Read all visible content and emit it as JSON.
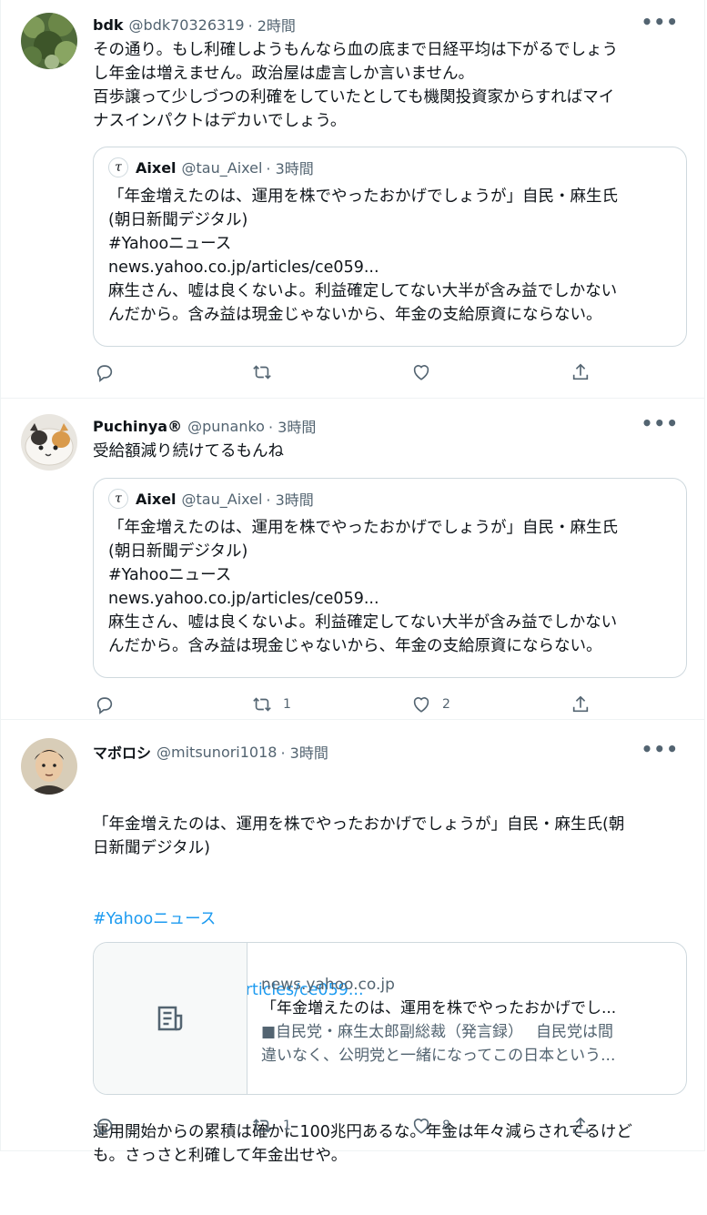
{
  "tweets": [
    {
      "name": "bdk",
      "handle": "@bdk70326319",
      "time": "· 2時間",
      "text": "その通り。もし利確しようもんなら血の底まで日経平均は下がるでしょう\nし年金は増えません。政治屋は虚言しか言いません。\n百歩譲って少しづつの利確をしていたとしても機関投資家からすればマイ\nナスインパクトはデカいでしょう。",
      "quote": {
        "name": "Aixel",
        "avatar_glyph": "τ",
        "handle": "@tau_Aixel",
        "time": "· 3時間",
        "text": "「年金増えたのは、運用を株でやったおかげでしょうが」自民・麻生氏\n(朝日新聞デジタル)\n#Yahooニュース\nnews.yahoo.co.jp/articles/ce059...\n麻生さん、嘘は良くないよ。利益確定してない大半が含み益でしかない\nんだから。含み益は現金じゃないから、年金の支給原資にならない。"
      },
      "retweets": "",
      "likes": ""
    },
    {
      "name": "Puchinya®",
      "handle": "@punanko",
      "time": "· 3時間",
      "text": "受給額減り続けてるもんね",
      "quote": {
        "name": "Aixel",
        "avatar_glyph": "τ",
        "handle": "@tau_Aixel",
        "time": "· 3時間",
        "text": "「年金増えたのは、運用を株でやったおかげでしょうが」自民・麻生氏\n(朝日新聞デジタル)\n#Yahooニュース\nnews.yahoo.co.jp/articles/ce059...\n麻生さん、嘘は良くないよ。利益確定してない大半が含み益でしかない\nんだから。含み益は現金じゃないから、年金の支給原資にならない。"
      },
      "retweets": "1",
      "likes": "2"
    },
    {
      "name": "マボロシ",
      "handle": "@mitsunori1018",
      "time": "· 3時間",
      "text_line1": "「年金増えたのは、運用を株でやったおかげでしょうが」自民・麻生氏(朝\n日新聞デジタル)",
      "hashtag": "#Yahooニュース",
      "url": "news.yahoo.co.jp/articles/ce059...",
      "text_line2": "運用開始からの累積は確かに100兆円あるな。年金は年々減らされてるけど\nも。さっさと利確して年金出せや。",
      "card": {
        "domain": "news.yahoo.co.jp",
        "title": "「年金増えたのは、運用を株でやったおかげでし...",
        "description1": "■自民党・麻生太郎副総裁（発言録）　  自民党は間",
        "description2": "違いなく、公明党と一緒になってこの日本という..."
      },
      "retweets": "1",
      "likes": "8"
    }
  ],
  "icons": [
    "reply-icon",
    "retweet-icon",
    "like-icon",
    "share-icon",
    "more-icon",
    "article-icon"
  ],
  "colors": {
    "link": "#1d9bf0",
    "muted": "#536471",
    "border": "#cfd9de"
  }
}
